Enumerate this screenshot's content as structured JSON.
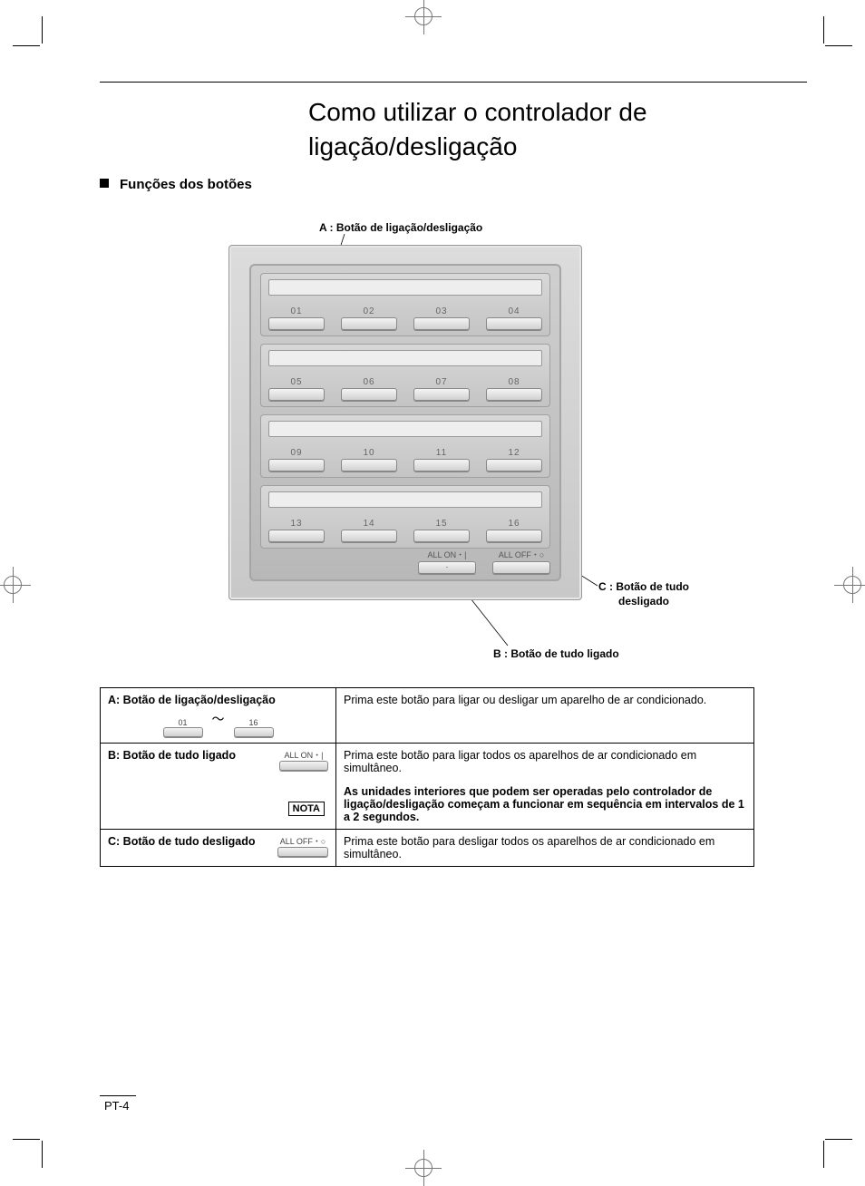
{
  "title_line1": "Como utilizar o controlador de",
  "title_line2": "ligação/desligação",
  "section_heading": "Funções dos botões",
  "callouts": {
    "a": "A : Botão de ligação/desligação",
    "b": "B :  Botão de tudo ligado",
    "c_line1": "C : Botão de tudo",
    "c_line2": "desligado"
  },
  "panel": {
    "buttons": [
      "01",
      "02",
      "03",
      "04",
      "05",
      "06",
      "07",
      "08",
      "09",
      "10",
      "11",
      "12",
      "13",
      "14",
      "15",
      "16"
    ],
    "all_on": "ALL ON・|",
    "all_off": "ALL OFF・○"
  },
  "table": {
    "rowA": {
      "label": "A: Botão de ligação/desligação",
      "mini_left": "01",
      "mini_right": "16",
      "desc": "Prima este botão para ligar ou desligar um aparelho de ar condicionado."
    },
    "rowB": {
      "label": "B: Botão de tudo ligado",
      "mini": "ALL ON・|",
      "desc": "Prima este botão para ligar todos os aparelhos de ar condicionado em simultâneo.",
      "nota_label": "NOTA",
      "nota_text": "As unidades interiores que podem ser operadas pelo controlador de ligação/desligação começam a funcionar em sequência em intervalos de 1 a 2 segundos."
    },
    "rowC": {
      "label": "C: Botão de tudo desligado",
      "mini": "ALL OFF・○",
      "desc": "Prima este botão para desligar todos os aparelhos de ar condicionado em simultâneo."
    }
  },
  "page_number": "PT-4"
}
